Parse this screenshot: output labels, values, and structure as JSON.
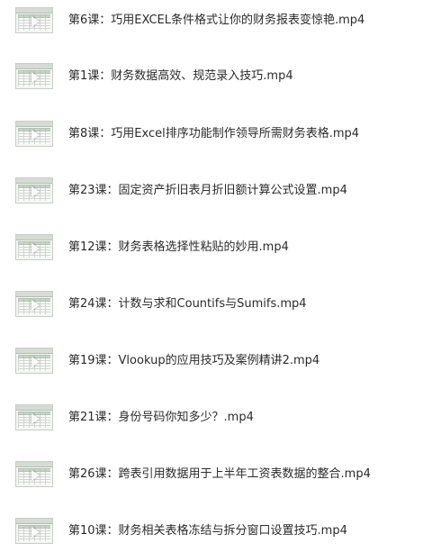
{
  "files": [
    {
      "name": "第6课：巧用EXCEL条件格式让你的财务报表变惊艳.mp4",
      "icon": "video-file-icon"
    },
    {
      "name": "第1课：财务数据高效、规范录入技巧.mp4",
      "icon": "video-file-icon"
    },
    {
      "name": "第8课：巧用Excel排序功能制作领导所需财务表格.mp4",
      "icon": "video-file-icon"
    },
    {
      "name": "第23课：固定资产折旧表月折旧额计算公式设置.mp4",
      "icon": "video-file-icon"
    },
    {
      "name": "第12课：财务表格选择性粘贴的妙用.mp4",
      "icon": "video-file-icon"
    },
    {
      "name": "第24课：计数与求和Countifs与Sumifs.mp4",
      "icon": "video-file-icon"
    },
    {
      "name": "第19课：Vlookup的应用技巧及案例精讲2.mp4",
      "icon": "video-file-icon"
    },
    {
      "name": "第21课：身份号码你知多少？.mp4",
      "icon": "video-file-icon"
    },
    {
      "name": "第26课：跨表引用数据用于上半年工资表数据的整合.mp4",
      "icon": "video-file-icon"
    },
    {
      "name": "第10课：财务相关表格冻结与拆分窗口设置技巧.mp4",
      "icon": "video-file-icon"
    }
  ]
}
